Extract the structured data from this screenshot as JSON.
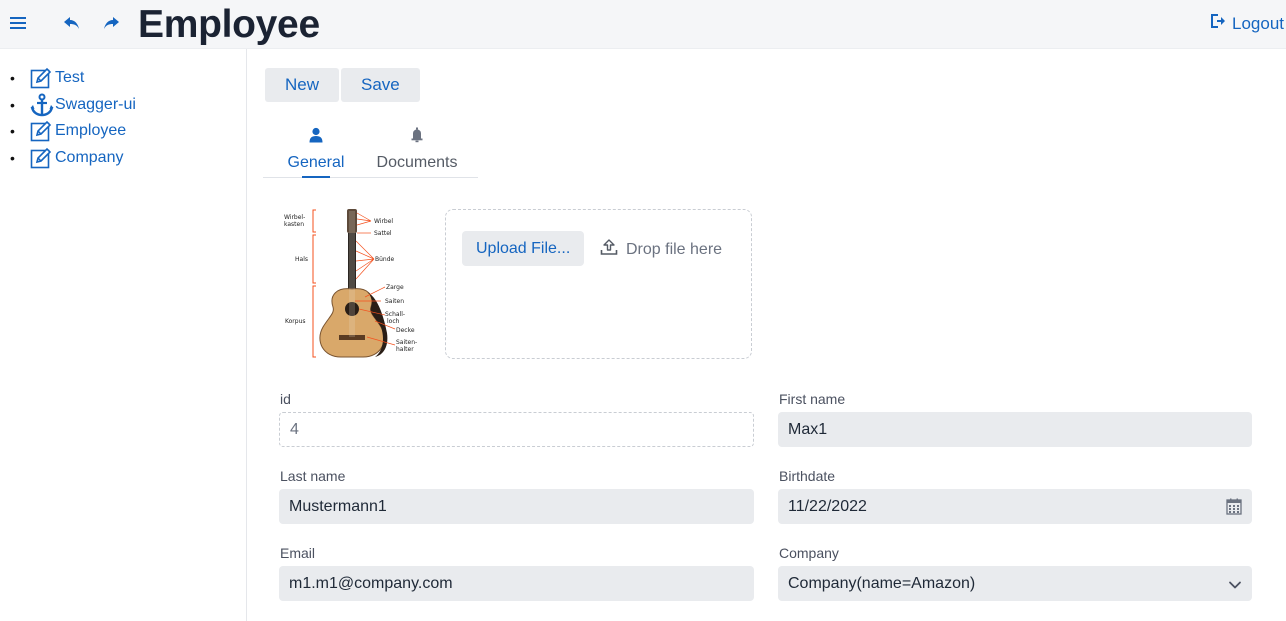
{
  "header": {
    "title": "Employee",
    "logout_label": "Logout",
    "menu_icon": "menu-icon",
    "undo_icon": "undo-icon",
    "redo_icon": "redo-icon",
    "logout_icon": "logout-icon"
  },
  "sidebar": {
    "items": [
      {
        "label": "Test",
        "icon": "edit-icon"
      },
      {
        "label": "Swagger-ui",
        "icon": "anchor-icon"
      },
      {
        "label": "Employee",
        "icon": "edit-icon"
      },
      {
        "label": "Company",
        "icon": "edit-icon"
      }
    ]
  },
  "toolbar": {
    "new_label": "New",
    "save_label": "Save"
  },
  "tabs": [
    {
      "label": "General",
      "icon": "user-icon",
      "selected": true
    },
    {
      "label": "Documents",
      "icon": "bell-icon",
      "selected": false
    }
  ],
  "photo": {
    "labels_left": [
      "Wirbel-",
      "kasten",
      "Hals",
      "Korpus"
    ],
    "labels_right": [
      "Wirbel",
      "Sattel",
      "Bünde",
      "Zarge",
      "Saiten",
      "Schall-",
      "loch",
      "Decke",
      "Saiten-",
      "halter"
    ]
  },
  "upload": {
    "button_label": "Upload File...",
    "drop_hint": "Drop file here"
  },
  "form": {
    "id": {
      "label": "id",
      "value": "4"
    },
    "first_name": {
      "label": "First name",
      "value": "Max1"
    },
    "last_name": {
      "label": "Last name",
      "value": "Mustermann1"
    },
    "birthdate": {
      "label": "Birthdate",
      "value": "11/22/2022"
    },
    "email": {
      "label": "Email",
      "value": "m1.m1@company.com"
    },
    "company": {
      "label": "Company",
      "value": "Company(name=Amazon)"
    }
  },
  "colors": {
    "accent": "#1565c0",
    "header_bg": "#f5f6f8",
    "field_bg": "#e9ebee",
    "title_text": "#1b2333"
  }
}
